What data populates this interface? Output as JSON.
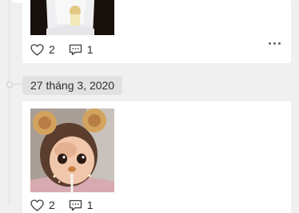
{
  "posts": [
    {
      "likes": "2",
      "comments": "1"
    },
    {
      "likes": "2",
      "comments": "1"
    }
  ],
  "date_separator": "27 tháng 3, 2020",
  "icons": {
    "like": "heart-icon",
    "comment": "comment-icon",
    "more": "more-dots-icon"
  }
}
